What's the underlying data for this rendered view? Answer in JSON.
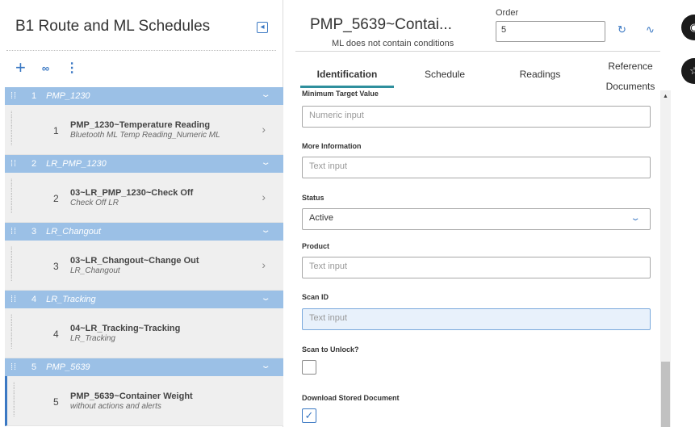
{
  "left_panel": {
    "title": "B1 Route and ML Schedules",
    "collapse_icon": "chevron-left-box-icon",
    "toolbar": {
      "add_icon": "+",
      "search_icon": "binoculars",
      "more_icon": "⋮"
    },
    "groups": [
      {
        "number": "1",
        "name": "PMP_1230",
        "items": [
          {
            "number": "1",
            "title": "PMP_1230~Temperature Reading",
            "subtitle": "Bluetooth ML Temp Reading_Numeric ML"
          }
        ]
      },
      {
        "number": "2",
        "name": "LR_PMP_1230",
        "items": [
          {
            "number": "2",
            "title": "03~LR_PMP_1230~Check Off",
            "subtitle": "Check Off LR"
          }
        ]
      },
      {
        "number": "3",
        "name": "LR_Changout",
        "items": [
          {
            "number": "3",
            "title": "03~LR_Changout~Change Out",
            "subtitle": "LR_Changout"
          }
        ]
      },
      {
        "number": "4",
        "name": "LR_Tracking",
        "items": [
          {
            "number": "4",
            "title": "04~LR_Tracking~Tracking",
            "subtitle": "LR_Tracking"
          }
        ]
      },
      {
        "number": "5",
        "name": "PMP_5639",
        "items": [
          {
            "number": "5",
            "title": "PMP_5639~Container Weight",
            "subtitle": "without actions and alerts"
          }
        ]
      }
    ]
  },
  "header": {
    "title": "PMP_5639~Contai...",
    "subtitle": "ML does not contain conditions",
    "order_label": "Order",
    "order_value": "5",
    "refresh_icon": "refresh-icon",
    "chart_icon": "trend-icon"
  },
  "tabs": [
    {
      "label": "Identification",
      "active": true
    },
    {
      "label": "Schedule",
      "active": false
    },
    {
      "label": "Readings",
      "active": false
    },
    {
      "label": "Reference",
      "label2": "Documents",
      "active": false
    }
  ],
  "form": {
    "min_target_label": "Minimum Target Value",
    "min_target_placeholder": "Numeric input",
    "more_info_label": "More Information",
    "more_info_placeholder": "Text input",
    "status_label": "Status",
    "status_value": "Active",
    "product_label": "Product",
    "product_placeholder": "Text input",
    "scan_id_label": "Scan ID",
    "scan_id_placeholder": "Text input",
    "scan_unlock_label": "Scan to Unlock?",
    "scan_unlock_checked": false,
    "download_label": "Download Stored Document",
    "download_checked": true
  },
  "colors": {
    "accent": "#3a78c3",
    "group_header": "#9bc0e6",
    "tab_underline": "#2f8f9d"
  }
}
